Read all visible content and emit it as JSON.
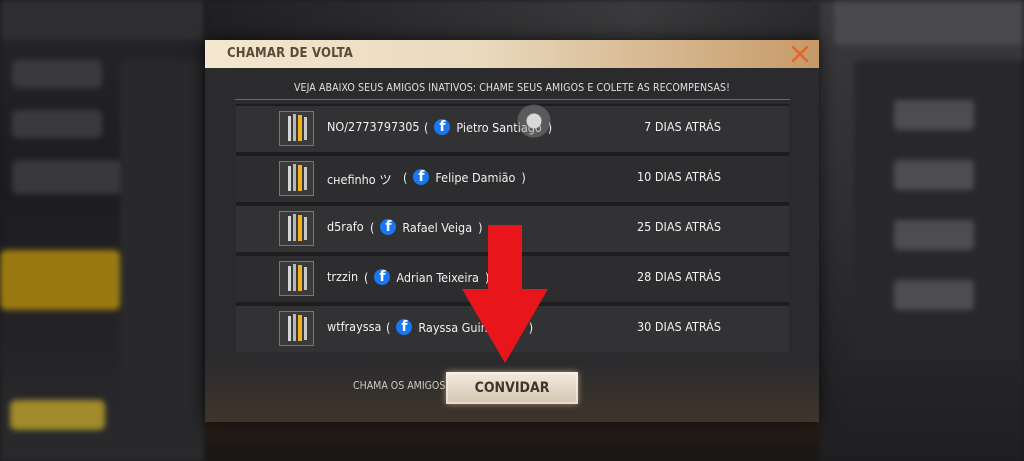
{
  "dialog": {
    "title": "CHAMAR DE VOLTA",
    "subtitle": "VEJA ABAIXO SEUS AMIGOS INATIVOS: CHAME SEUS AMIGOS E COLETE AS RECOMPENSAS!",
    "close_icon": "close-x-icon",
    "accent_color": "#e8632a"
  },
  "friends": [
    {
      "nickname": "NO/2773797305",
      "facebook_name": "Pietro Santiago",
      "last_seen": "7 DIAS ATRÁS"
    },
    {
      "nickname": "ᴄʜefinhᴏ ツ",
      "facebook_name": "Felipe Damião",
      "last_seen": "10 DIAS ATRÁS"
    },
    {
      "nickname": "d5rafo",
      "facebook_name": "Rafael Veiga",
      "last_seen": "25 DIAS ATRÁS"
    },
    {
      "nickname": "trzzin",
      "facebook_name": "Adrian Teixeira",
      "last_seen": "28 DIAS ATRÁS"
    },
    {
      "nickname": "wtfrayssa",
      "facebook_name": "Rayssa Guimarães",
      "last_seen": "30 DIAS ATRÁS"
    }
  ],
  "footer": {
    "label": "CHAMA OS AMIGOS!",
    "invite_button": "CONVIDAR"
  },
  "annotation": {
    "arrow_color": "#e8161b"
  }
}
